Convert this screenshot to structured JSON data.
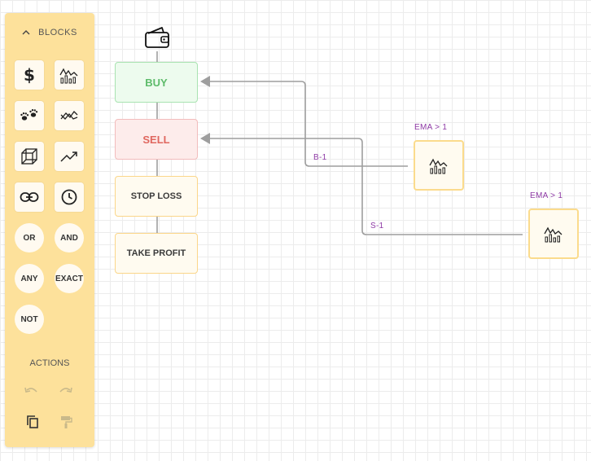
{
  "sidebar": {
    "header": "BLOCKS",
    "tiles": [
      {
        "icon": "dollar-icon"
      },
      {
        "icon": "indicator-chart-icon"
      },
      {
        "icon": "paws-icon"
      },
      {
        "icon": "crossover-icon"
      },
      {
        "icon": "cube-icon"
      },
      {
        "icon": "trend-up-icon"
      },
      {
        "icon": "link-icon"
      },
      {
        "icon": "clock-icon"
      }
    ],
    "logic": [
      "OR",
      "AND",
      "ANY",
      "EXACT",
      "NOT"
    ],
    "actions_label": "ACTIONS",
    "actions": [
      {
        "icon": "undo-icon",
        "enabled": false
      },
      {
        "icon": "redo-icon",
        "enabled": false
      },
      {
        "icon": "copy-icon",
        "enabled": true
      },
      {
        "icon": "paint-roller-icon",
        "enabled": false
      }
    ]
  },
  "canvas": {
    "root": {
      "icon": "wallet-icon"
    },
    "nodes": [
      {
        "label": "BUY",
        "color": "#5dbb6a"
      },
      {
        "label": "SELL",
        "color": "#e0675f"
      },
      {
        "label": "STOP LOSS",
        "color": "#3a3a3a"
      },
      {
        "label": "TAKE PROFIT",
        "color": "#3a3a3a"
      }
    ],
    "indicators": [
      {
        "label": "EMA > 1",
        "icon": "indicator-chart-icon"
      },
      {
        "label": "EMA > 1",
        "icon": "indicator-chart-icon"
      }
    ],
    "edges": [
      {
        "label": "B-1",
        "from": "indicator-1",
        "to": "BUY"
      },
      {
        "label": "S-1",
        "from": "indicator-2",
        "to": "SELL"
      }
    ]
  },
  "colors": {
    "sidebar_bg": "#fde19b",
    "buy": "#5dbb6a",
    "sell": "#e0675f",
    "label_purple": "#8e3aa5",
    "wire": "#9e9e9e"
  }
}
